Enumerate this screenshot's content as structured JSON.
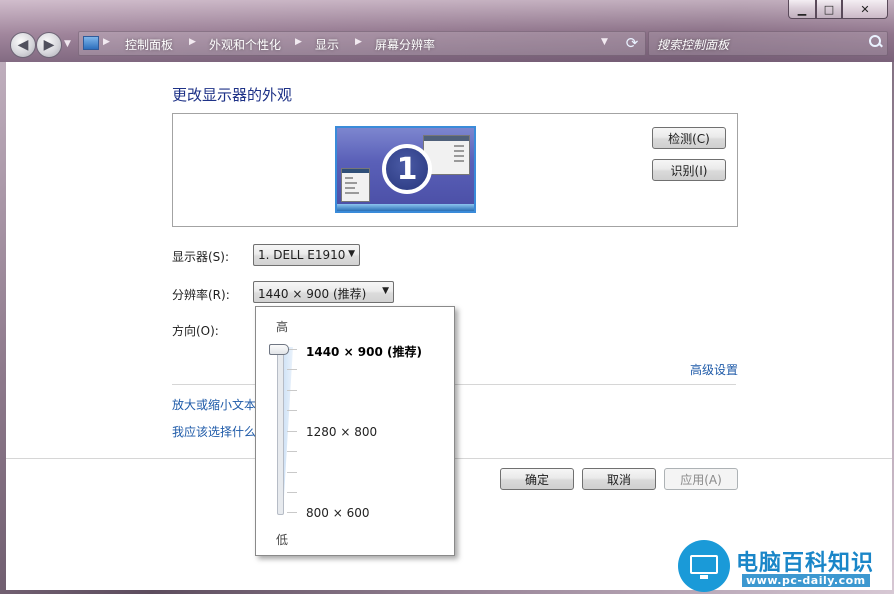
{
  "window": {
    "caption_min": "▁",
    "caption_max": "□",
    "caption_close": "✕"
  },
  "address_bar": {
    "breadcrumbs": [
      "控制面板",
      "外观和个性化",
      "显示",
      "屏幕分辨率"
    ]
  },
  "search": {
    "placeholder": "搜索控制面板"
  },
  "page": {
    "title": "更改显示器的外观",
    "monitor_number": "1",
    "detect_button": "检测(C)",
    "identify_button": "识别(I)",
    "display_label": "显示器(S):",
    "display_value": "1. DELL E1910",
    "resolution_label": "分辨率(R):",
    "resolution_value": "1440 × 900 (推荐)",
    "orientation_label": "方向(O):",
    "advanced_link": "高级设置",
    "zoom_link": "放大或缩小文本",
    "help_link": "我应该选择什么"
  },
  "resolution_popup": {
    "high_label": "高",
    "low_label": "低",
    "options": [
      "1440 × 900 (推荐)",
      "1280 × 800",
      "800 × 600"
    ],
    "selected_index": 0
  },
  "buttons": {
    "ok": "确定",
    "cancel": "取消",
    "apply": "应用(A)"
  },
  "watermark": {
    "title": "电脑百科知识",
    "url": "www.pc-daily.com"
  }
}
